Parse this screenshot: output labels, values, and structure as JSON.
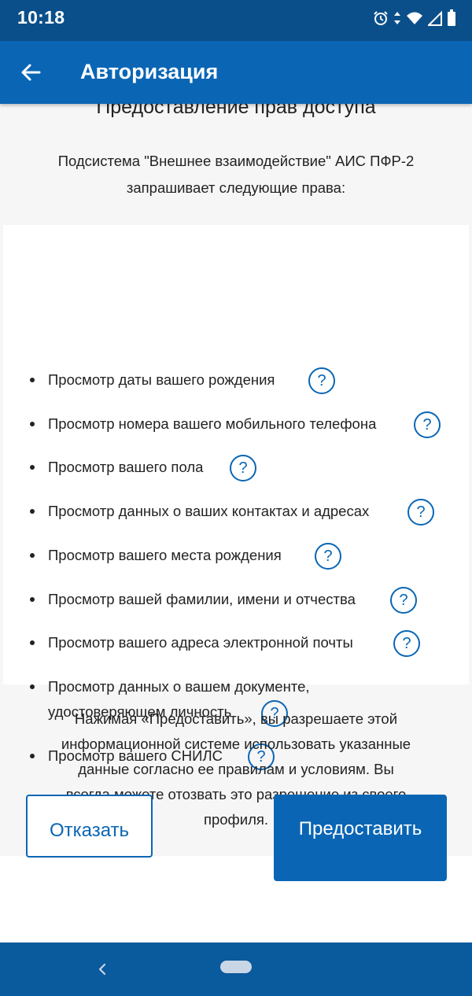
{
  "status_bar": {
    "time": "10:18",
    "icons": [
      "alarm-icon",
      "data-arrows-icon",
      "wifi-icon",
      "signal-icon",
      "battery-icon"
    ]
  },
  "app_bar": {
    "title": "Авторизация",
    "back_icon": "arrow-left-icon"
  },
  "page": {
    "section_title": "Предоставление прав доступа",
    "intro": "Подсистема \"Внешнее взаимодействие\" АИС ПФР-2 запрашивает следующие права:"
  },
  "permissions": [
    {
      "label": "Просмотр даты вашего рождения"
    },
    {
      "label": "Просмотр номера вашего мобильного телефона"
    },
    {
      "label": "Просмотр вашего пола"
    },
    {
      "label": "Просмотр данных о ваших контактах и адресах"
    },
    {
      "label": "Просмотр вашего места рождения"
    },
    {
      "label": "Просмотр вашей фамилии, имени и отчества"
    },
    {
      "label": "Просмотр вашего адреса электронной почты"
    },
    {
      "label_line1": "Просмотр данных о вашем документе,",
      "label_line2": "удостоверяющем личность"
    },
    {
      "label": "Просмотр вашего СНИЛС"
    }
  ],
  "help_symbol": "?",
  "disclaimer": "Нажимая «Предоставить», вы разрешаете этой информационной системе использовать указанные данные согласно ее правилам и условиям. Вы всегда можете отозвать это разрешение из своего профиля.",
  "buttons": {
    "decline": "Отказать",
    "grant": "Предоставить"
  },
  "nav_bar": {
    "icons": [
      "nav-back-icon",
      "home-pill-icon"
    ]
  },
  "colors": {
    "status_bar": "#0b4f8a",
    "app_bar": "#0a66b5",
    "accent": "#0a66b5",
    "nav_bar": "#0a5a9e"
  }
}
